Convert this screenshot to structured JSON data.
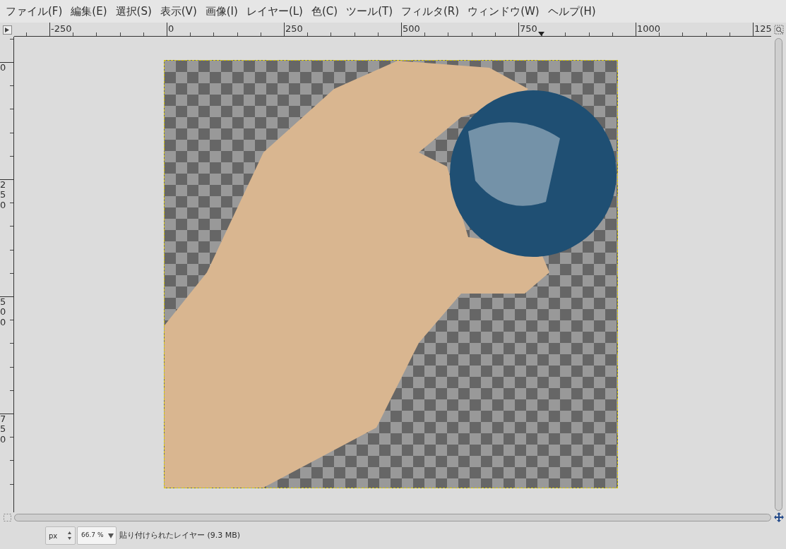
{
  "menu": [
    "ファイル(F)",
    "編集(E)",
    "選択(S)",
    "表示(V)",
    "画像(I)",
    "レイヤー(L)",
    "色(C)",
    "ツール(T)",
    "フィルタ(R)",
    "ウィンドウ(W)",
    "ヘルプ(H)"
  ],
  "ruler_horizontal": [
    "-250",
    "0",
    "250",
    "500",
    "750",
    "1000",
    "125"
  ],
  "ruler_vertical": [
    "0",
    "250",
    "500",
    "750"
  ],
  "status_bar": {
    "unit": "px",
    "zoom": "66.7 %",
    "layer_info": "貼り付けられたレイヤー (9.3 MB)"
  }
}
